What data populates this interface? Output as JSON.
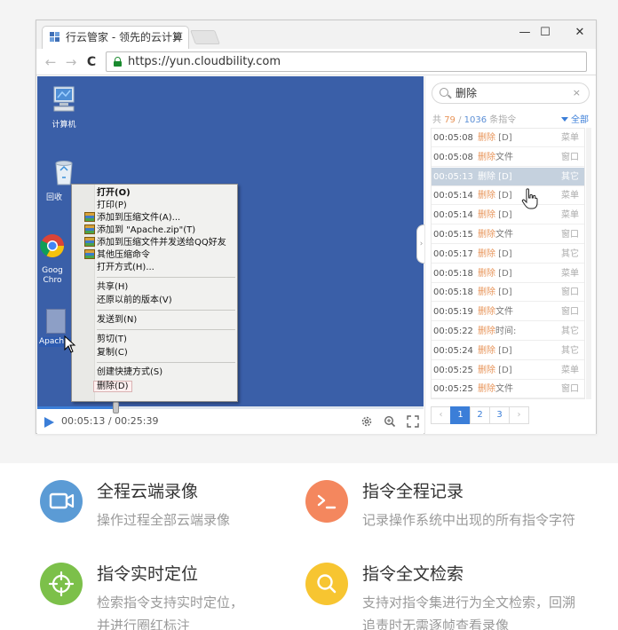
{
  "browser": {
    "tab_title": "行云管家 - 领先的云计算",
    "tab_close": "×",
    "window_controls": {
      "minimize": "—",
      "maximize": "☐",
      "close": "✕"
    },
    "nav": {
      "back": "←",
      "forward": "→",
      "reload": "C"
    },
    "url": "https://yun.cloudbility.com"
  },
  "desktop": {
    "icons": [
      {
        "label": "计算机"
      },
      {
        "label": "回收"
      },
      {
        "label": "Goog Chro"
      },
      {
        "label": "Apache"
      }
    ],
    "context_menu": {
      "items": [
        {
          "label": "打开(O)",
          "bold": true
        },
        {
          "label": "打印(P)"
        },
        {
          "label": "添加到压缩文件(A)...",
          "zip": true
        },
        {
          "label": "添加到 \"Apache.zip\"(T)",
          "zip": true
        },
        {
          "label": "添加到压缩文件并发送给QQ好友",
          "zip": true
        },
        {
          "label": "其他压缩命令",
          "zip": true
        },
        {
          "label": "打开方式(H)..."
        },
        {
          "label": "共享(H)"
        },
        {
          "label": "还原以前的版本(V)"
        },
        {
          "label": "发送到(N)"
        },
        {
          "label": "剪切(T)"
        },
        {
          "label": "复制(C)"
        },
        {
          "label": "创建快捷方式(S)"
        },
        {
          "label": "删除(D)",
          "highlight": true
        }
      ]
    }
  },
  "player": {
    "time": "00:05:13 / 00:25:39",
    "progress": 0.203,
    "icons": [
      "settings-icon",
      "zoom-icon",
      "fullscreen-icon"
    ]
  },
  "search_panel": {
    "query": "删除",
    "clear": "×",
    "count_prefix": "共 ",
    "count_match": "79",
    "count_sep": " / ",
    "count_total": "1036",
    "count_suffix": " 条指令",
    "filter_label": "全部",
    "results": [
      {
        "time": "00:05:08",
        "kw": "删除",
        "rest": " [D]",
        "cat": "菜单"
      },
      {
        "time": "00:05:08",
        "kw": "删除",
        "rest": "文件",
        "cat": "窗口"
      },
      {
        "time": "00:05:13",
        "kw": "删除",
        "rest": " [D]",
        "cat": "其它",
        "active": true
      },
      {
        "time": "00:05:14",
        "kw": "删除",
        "rest": " [D]",
        "cat": "菜单"
      },
      {
        "time": "00:05:14",
        "kw": "删除",
        "rest": " [D]",
        "cat": "菜单"
      },
      {
        "time": "00:05:15",
        "kw": "删除",
        "rest": "文件",
        "cat": "窗口"
      },
      {
        "time": "00:05:17",
        "kw": "删除",
        "rest": " [D]",
        "cat": "其它"
      },
      {
        "time": "00:05:18",
        "kw": "删除",
        "rest": " [D]",
        "cat": "菜单"
      },
      {
        "time": "00:05:18",
        "kw": "删除",
        "rest": " [D]",
        "cat": "窗口"
      },
      {
        "time": "00:05:19",
        "kw": "删除",
        "rest": "文件",
        "cat": "窗口"
      },
      {
        "time": "00:05:22",
        "kw": "删除",
        "rest": "时间:",
        "cat": "其它"
      },
      {
        "time": "00:05:24",
        "kw": "删除",
        "rest": " [D]",
        "cat": "其它"
      },
      {
        "time": "00:05:25",
        "kw": "删除",
        "rest": " [D]",
        "cat": "菜单"
      },
      {
        "time": "00:05:25",
        "kw": "删除",
        "rest": "文件",
        "cat": "窗口"
      }
    ],
    "pagination": {
      "prev": "‹",
      "pages": [
        "1",
        "2",
        "3"
      ],
      "next": "›",
      "current": "1"
    }
  },
  "features": [
    {
      "title": "全程云端录像",
      "desc": [
        "操作过程全部云端录像"
      ],
      "color": "#5b9bd5",
      "icon": "video-icon"
    },
    {
      "title": "指令全程记录",
      "desc": [
        "记录操作系统中出现的所有指令字符"
      ],
      "color": "#f4875e",
      "icon": "terminal-icon"
    },
    {
      "title": "指令实时定位",
      "desc": [
        "检索指令支持实时定位，",
        "并进行圈红标注"
      ],
      "color": "#7cc04a",
      "icon": "crosshair-icon"
    },
    {
      "title": "指令全文检索",
      "desc": [
        "支持对指令集进行为全文检索，回溯",
        "追责时无需逐帧查看录像"
      ],
      "color": "#f7c531",
      "icon": "magnifier-icon"
    }
  ]
}
